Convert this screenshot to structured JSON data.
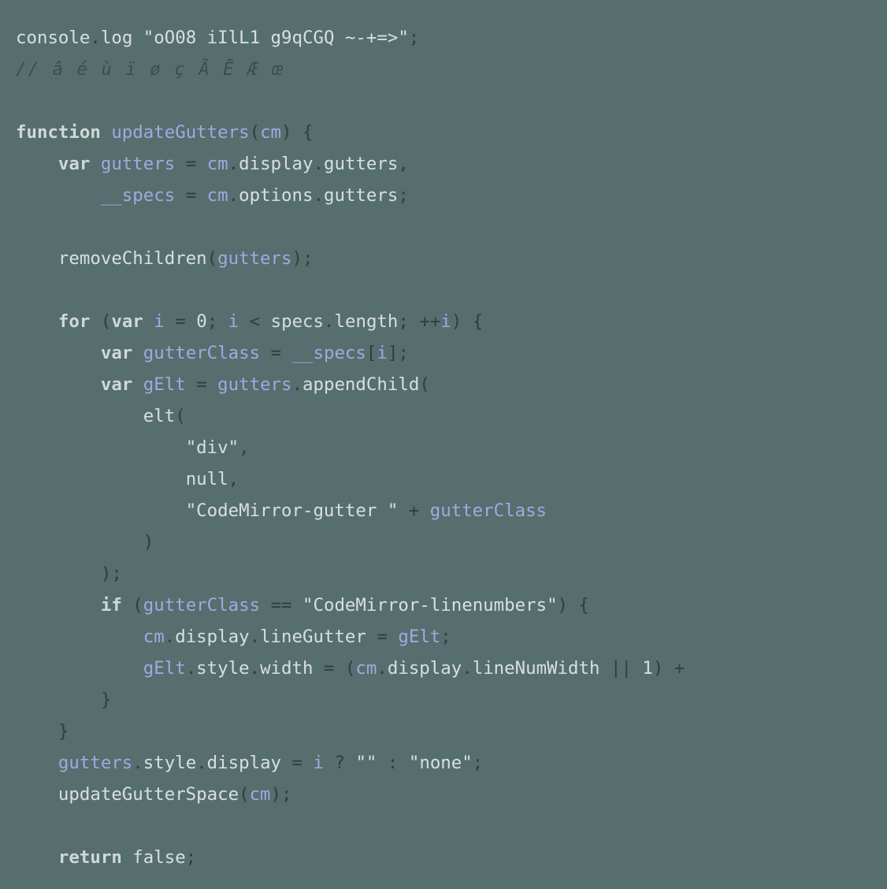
{
  "theme": {
    "background": "#566e6e",
    "default_fg": "#d7e0de",
    "comment_fg": "#3b4f50",
    "identifier_fg": "#a0a9e0",
    "punct_fg": "#2f3e3f"
  },
  "lines": [
    {
      "indent": 0,
      "tokens": [
        {
          "t": "console",
          "c": "tok-default"
        },
        {
          "t": ".",
          "c": "tok-punct"
        },
        {
          "t": "log",
          "c": "tok-call"
        },
        {
          "t": " ",
          "c": "tok-default"
        },
        {
          "t": "\"oO08 iIlL1 g9qCGQ ~-+=>\"",
          "c": "tok-string"
        },
        {
          "t": ";",
          "c": "tok-punct"
        }
      ]
    },
    {
      "indent": 0,
      "tokens": [
        {
          "t": "// â é ù ï ø ç Ã Ē Æ œ",
          "c": "tok-comment"
        }
      ]
    },
    {
      "indent": 0,
      "tokens": []
    },
    {
      "indent": 0,
      "tokens": [
        {
          "t": "function",
          "c": "tok-keyword"
        },
        {
          "t": " ",
          "c": "tok-default"
        },
        {
          "t": "updateGutters",
          "c": "tok-funcdecl"
        },
        {
          "t": "(",
          "c": "tok-punct"
        },
        {
          "t": "cm",
          "c": "tok-param"
        },
        {
          "t": ")",
          "c": "tok-punct"
        },
        {
          "t": " ",
          "c": "tok-default"
        },
        {
          "t": "{",
          "c": "tok-punct"
        }
      ]
    },
    {
      "indent": 1,
      "tokens": [
        {
          "t": "var",
          "c": "tok-keyword"
        },
        {
          "t": " ",
          "c": "tok-default"
        },
        {
          "t": "gutters",
          "c": "tok-ident"
        },
        {
          "t": " ",
          "c": "tok-default"
        },
        {
          "t": "=",
          "c": "tok-operator"
        },
        {
          "t": " ",
          "c": "tok-default"
        },
        {
          "t": "cm",
          "c": "tok-ident"
        },
        {
          "t": ".",
          "c": "tok-punct"
        },
        {
          "t": "display",
          "c": "tok-default"
        },
        {
          "t": ".",
          "c": "tok-punct"
        },
        {
          "t": "gutters",
          "c": "tok-default"
        },
        {
          "t": ",",
          "c": "tok-punct"
        }
      ]
    },
    {
      "indent": 2,
      "tokens": [
        {
          "t": "__specs",
          "c": "tok-ident"
        },
        {
          "t": " ",
          "c": "tok-default"
        },
        {
          "t": "=",
          "c": "tok-operator"
        },
        {
          "t": " ",
          "c": "tok-default"
        },
        {
          "t": "cm",
          "c": "tok-ident"
        },
        {
          "t": ".",
          "c": "tok-punct"
        },
        {
          "t": "options",
          "c": "tok-default"
        },
        {
          "t": ".",
          "c": "tok-punct"
        },
        {
          "t": "gutters",
          "c": "tok-default"
        },
        {
          "t": ";",
          "c": "tok-punct"
        }
      ]
    },
    {
      "indent": 0,
      "tokens": []
    },
    {
      "indent": 1,
      "tokens": [
        {
          "t": "removeChildren",
          "c": "tok-call"
        },
        {
          "t": "(",
          "c": "tok-punct"
        },
        {
          "t": "gutters",
          "c": "tok-ident"
        },
        {
          "t": ")",
          "c": "tok-punct"
        },
        {
          "t": ";",
          "c": "tok-punct"
        }
      ]
    },
    {
      "indent": 0,
      "tokens": []
    },
    {
      "indent": 1,
      "tokens": [
        {
          "t": "for",
          "c": "tok-keyword"
        },
        {
          "t": " ",
          "c": "tok-default"
        },
        {
          "t": "(",
          "c": "tok-punct"
        },
        {
          "t": "var",
          "c": "tok-keyword"
        },
        {
          "t": " ",
          "c": "tok-default"
        },
        {
          "t": "i",
          "c": "tok-ident"
        },
        {
          "t": " ",
          "c": "tok-default"
        },
        {
          "t": "=",
          "c": "tok-operator"
        },
        {
          "t": " ",
          "c": "tok-default"
        },
        {
          "t": "0",
          "c": "tok-number"
        },
        {
          "t": ";",
          "c": "tok-punct"
        },
        {
          "t": " ",
          "c": "tok-default"
        },
        {
          "t": "i",
          "c": "tok-ident"
        },
        {
          "t": " ",
          "c": "tok-default"
        },
        {
          "t": "<",
          "c": "tok-operator"
        },
        {
          "t": " ",
          "c": "tok-default"
        },
        {
          "t": "specs",
          "c": "tok-default"
        },
        {
          "t": ".",
          "c": "tok-punct"
        },
        {
          "t": "length",
          "c": "tok-default"
        },
        {
          "t": ";",
          "c": "tok-punct"
        },
        {
          "t": " ",
          "c": "tok-default"
        },
        {
          "t": "++",
          "c": "tok-operator"
        },
        {
          "t": "i",
          "c": "tok-ident"
        },
        {
          "t": ")",
          "c": "tok-punct"
        },
        {
          "t": " ",
          "c": "tok-default"
        },
        {
          "t": "{",
          "c": "tok-punct"
        }
      ]
    },
    {
      "indent": 2,
      "tokens": [
        {
          "t": "var",
          "c": "tok-keyword"
        },
        {
          "t": " ",
          "c": "tok-default"
        },
        {
          "t": "gutterClass",
          "c": "tok-ident"
        },
        {
          "t": " ",
          "c": "tok-default"
        },
        {
          "t": "=",
          "c": "tok-operator"
        },
        {
          "t": " ",
          "c": "tok-default"
        },
        {
          "t": "__specs",
          "c": "tok-ident"
        },
        {
          "t": "[",
          "c": "tok-punct"
        },
        {
          "t": "i",
          "c": "tok-ident"
        },
        {
          "t": "]",
          "c": "tok-punct"
        },
        {
          "t": ";",
          "c": "tok-punct"
        }
      ]
    },
    {
      "indent": 2,
      "tokens": [
        {
          "t": "var",
          "c": "tok-keyword"
        },
        {
          "t": " ",
          "c": "tok-default"
        },
        {
          "t": "gElt",
          "c": "tok-ident"
        },
        {
          "t": " ",
          "c": "tok-default"
        },
        {
          "t": "=",
          "c": "tok-operator"
        },
        {
          "t": " ",
          "c": "tok-default"
        },
        {
          "t": "gutters",
          "c": "tok-ident"
        },
        {
          "t": ".",
          "c": "tok-punct"
        },
        {
          "t": "appendChild",
          "c": "tok-call"
        },
        {
          "t": "(",
          "c": "tok-punct"
        }
      ]
    },
    {
      "indent": 3,
      "tokens": [
        {
          "t": "elt",
          "c": "tok-call"
        },
        {
          "t": "(",
          "c": "tok-punct"
        }
      ]
    },
    {
      "indent": 4,
      "tokens": [
        {
          "t": "\"div\"",
          "c": "tok-string"
        },
        {
          "t": ",",
          "c": "tok-punct"
        }
      ]
    },
    {
      "indent": 4,
      "tokens": [
        {
          "t": "null",
          "c": "tok-bool"
        },
        {
          "t": ",",
          "c": "tok-punct"
        }
      ]
    },
    {
      "indent": 4,
      "tokens": [
        {
          "t": "\"CodeMirror-gutter \"",
          "c": "tok-string"
        },
        {
          "t": " ",
          "c": "tok-default"
        },
        {
          "t": "+",
          "c": "tok-operator"
        },
        {
          "t": " ",
          "c": "tok-default"
        },
        {
          "t": "gutterClass",
          "c": "tok-ident"
        }
      ]
    },
    {
      "indent": 3,
      "tokens": [
        {
          "t": ")",
          "c": "tok-punct"
        }
      ]
    },
    {
      "indent": 2,
      "tokens": [
        {
          "t": ")",
          "c": "tok-punct"
        },
        {
          "t": ";",
          "c": "tok-punct"
        }
      ]
    },
    {
      "indent": 2,
      "tokens": [
        {
          "t": "if",
          "c": "tok-keyword"
        },
        {
          "t": " ",
          "c": "tok-default"
        },
        {
          "t": "(",
          "c": "tok-punct"
        },
        {
          "t": "gutterClass",
          "c": "tok-ident"
        },
        {
          "t": " ",
          "c": "tok-default"
        },
        {
          "t": "==",
          "c": "tok-operator"
        },
        {
          "t": " ",
          "c": "tok-default"
        },
        {
          "t": "\"CodeMirror-linenumbers\"",
          "c": "tok-string"
        },
        {
          "t": ")",
          "c": "tok-punct"
        },
        {
          "t": " ",
          "c": "tok-default"
        },
        {
          "t": "{",
          "c": "tok-punct"
        }
      ]
    },
    {
      "indent": 3,
      "tokens": [
        {
          "t": "cm",
          "c": "tok-ident"
        },
        {
          "t": ".",
          "c": "tok-punct"
        },
        {
          "t": "display",
          "c": "tok-default"
        },
        {
          "t": ".",
          "c": "tok-punct"
        },
        {
          "t": "lineGutter",
          "c": "tok-default"
        },
        {
          "t": " ",
          "c": "tok-default"
        },
        {
          "t": "=",
          "c": "tok-operator"
        },
        {
          "t": " ",
          "c": "tok-default"
        },
        {
          "t": "gElt",
          "c": "tok-ident"
        },
        {
          "t": ";",
          "c": "tok-punct"
        }
      ]
    },
    {
      "indent": 3,
      "tokens": [
        {
          "t": "gElt",
          "c": "tok-ident"
        },
        {
          "t": ".",
          "c": "tok-punct"
        },
        {
          "t": "style",
          "c": "tok-default"
        },
        {
          "t": ".",
          "c": "tok-punct"
        },
        {
          "t": "width",
          "c": "tok-default"
        },
        {
          "t": " ",
          "c": "tok-default"
        },
        {
          "t": "=",
          "c": "tok-operator"
        },
        {
          "t": " ",
          "c": "tok-default"
        },
        {
          "t": "(",
          "c": "tok-punct"
        },
        {
          "t": "cm",
          "c": "tok-ident"
        },
        {
          "t": ".",
          "c": "tok-punct"
        },
        {
          "t": "display",
          "c": "tok-default"
        },
        {
          "t": ".",
          "c": "tok-punct"
        },
        {
          "t": "lineNumWidth",
          "c": "tok-default"
        },
        {
          "t": " ",
          "c": "tok-default"
        },
        {
          "t": "||",
          "c": "tok-operator"
        },
        {
          "t": " ",
          "c": "tok-default"
        },
        {
          "t": "1",
          "c": "tok-number"
        },
        {
          "t": ")",
          "c": "tok-punct"
        },
        {
          "t": " ",
          "c": "tok-default"
        },
        {
          "t": "+",
          "c": "tok-operator"
        },
        {
          "t": " ",
          "c": "tok-default"
        }
      ]
    },
    {
      "indent": 2,
      "tokens": [
        {
          "t": "}",
          "c": "tok-punct"
        }
      ]
    },
    {
      "indent": 1,
      "tokens": [
        {
          "t": "}",
          "c": "tok-punct"
        }
      ]
    },
    {
      "indent": 1,
      "tokens": [
        {
          "t": "gutters",
          "c": "tok-ident"
        },
        {
          "t": ".",
          "c": "tok-punct"
        },
        {
          "t": "style",
          "c": "tok-default"
        },
        {
          "t": ".",
          "c": "tok-punct"
        },
        {
          "t": "display",
          "c": "tok-default"
        },
        {
          "t": " ",
          "c": "tok-default"
        },
        {
          "t": "=",
          "c": "tok-operator"
        },
        {
          "t": " ",
          "c": "tok-default"
        },
        {
          "t": "i",
          "c": "tok-ident"
        },
        {
          "t": " ",
          "c": "tok-default"
        },
        {
          "t": "?",
          "c": "tok-operator"
        },
        {
          "t": " ",
          "c": "tok-default"
        },
        {
          "t": "\"\"",
          "c": "tok-string"
        },
        {
          "t": " ",
          "c": "tok-default"
        },
        {
          "t": ":",
          "c": "tok-operator"
        },
        {
          "t": " ",
          "c": "tok-default"
        },
        {
          "t": "\"none\"",
          "c": "tok-string"
        },
        {
          "t": ";",
          "c": "tok-punct"
        }
      ]
    },
    {
      "indent": 1,
      "tokens": [
        {
          "t": "updateGutterSpace",
          "c": "tok-call"
        },
        {
          "t": "(",
          "c": "tok-punct"
        },
        {
          "t": "cm",
          "c": "tok-ident"
        },
        {
          "t": ")",
          "c": "tok-punct"
        },
        {
          "t": ";",
          "c": "tok-punct"
        }
      ]
    },
    {
      "indent": 0,
      "tokens": []
    },
    {
      "indent": 1,
      "tokens": [
        {
          "t": "return",
          "c": "tok-keyword"
        },
        {
          "t": " ",
          "c": "tok-default"
        },
        {
          "t": "false",
          "c": "tok-bool"
        },
        {
          "t": ";",
          "c": "tok-punct"
        }
      ]
    }
  ]
}
